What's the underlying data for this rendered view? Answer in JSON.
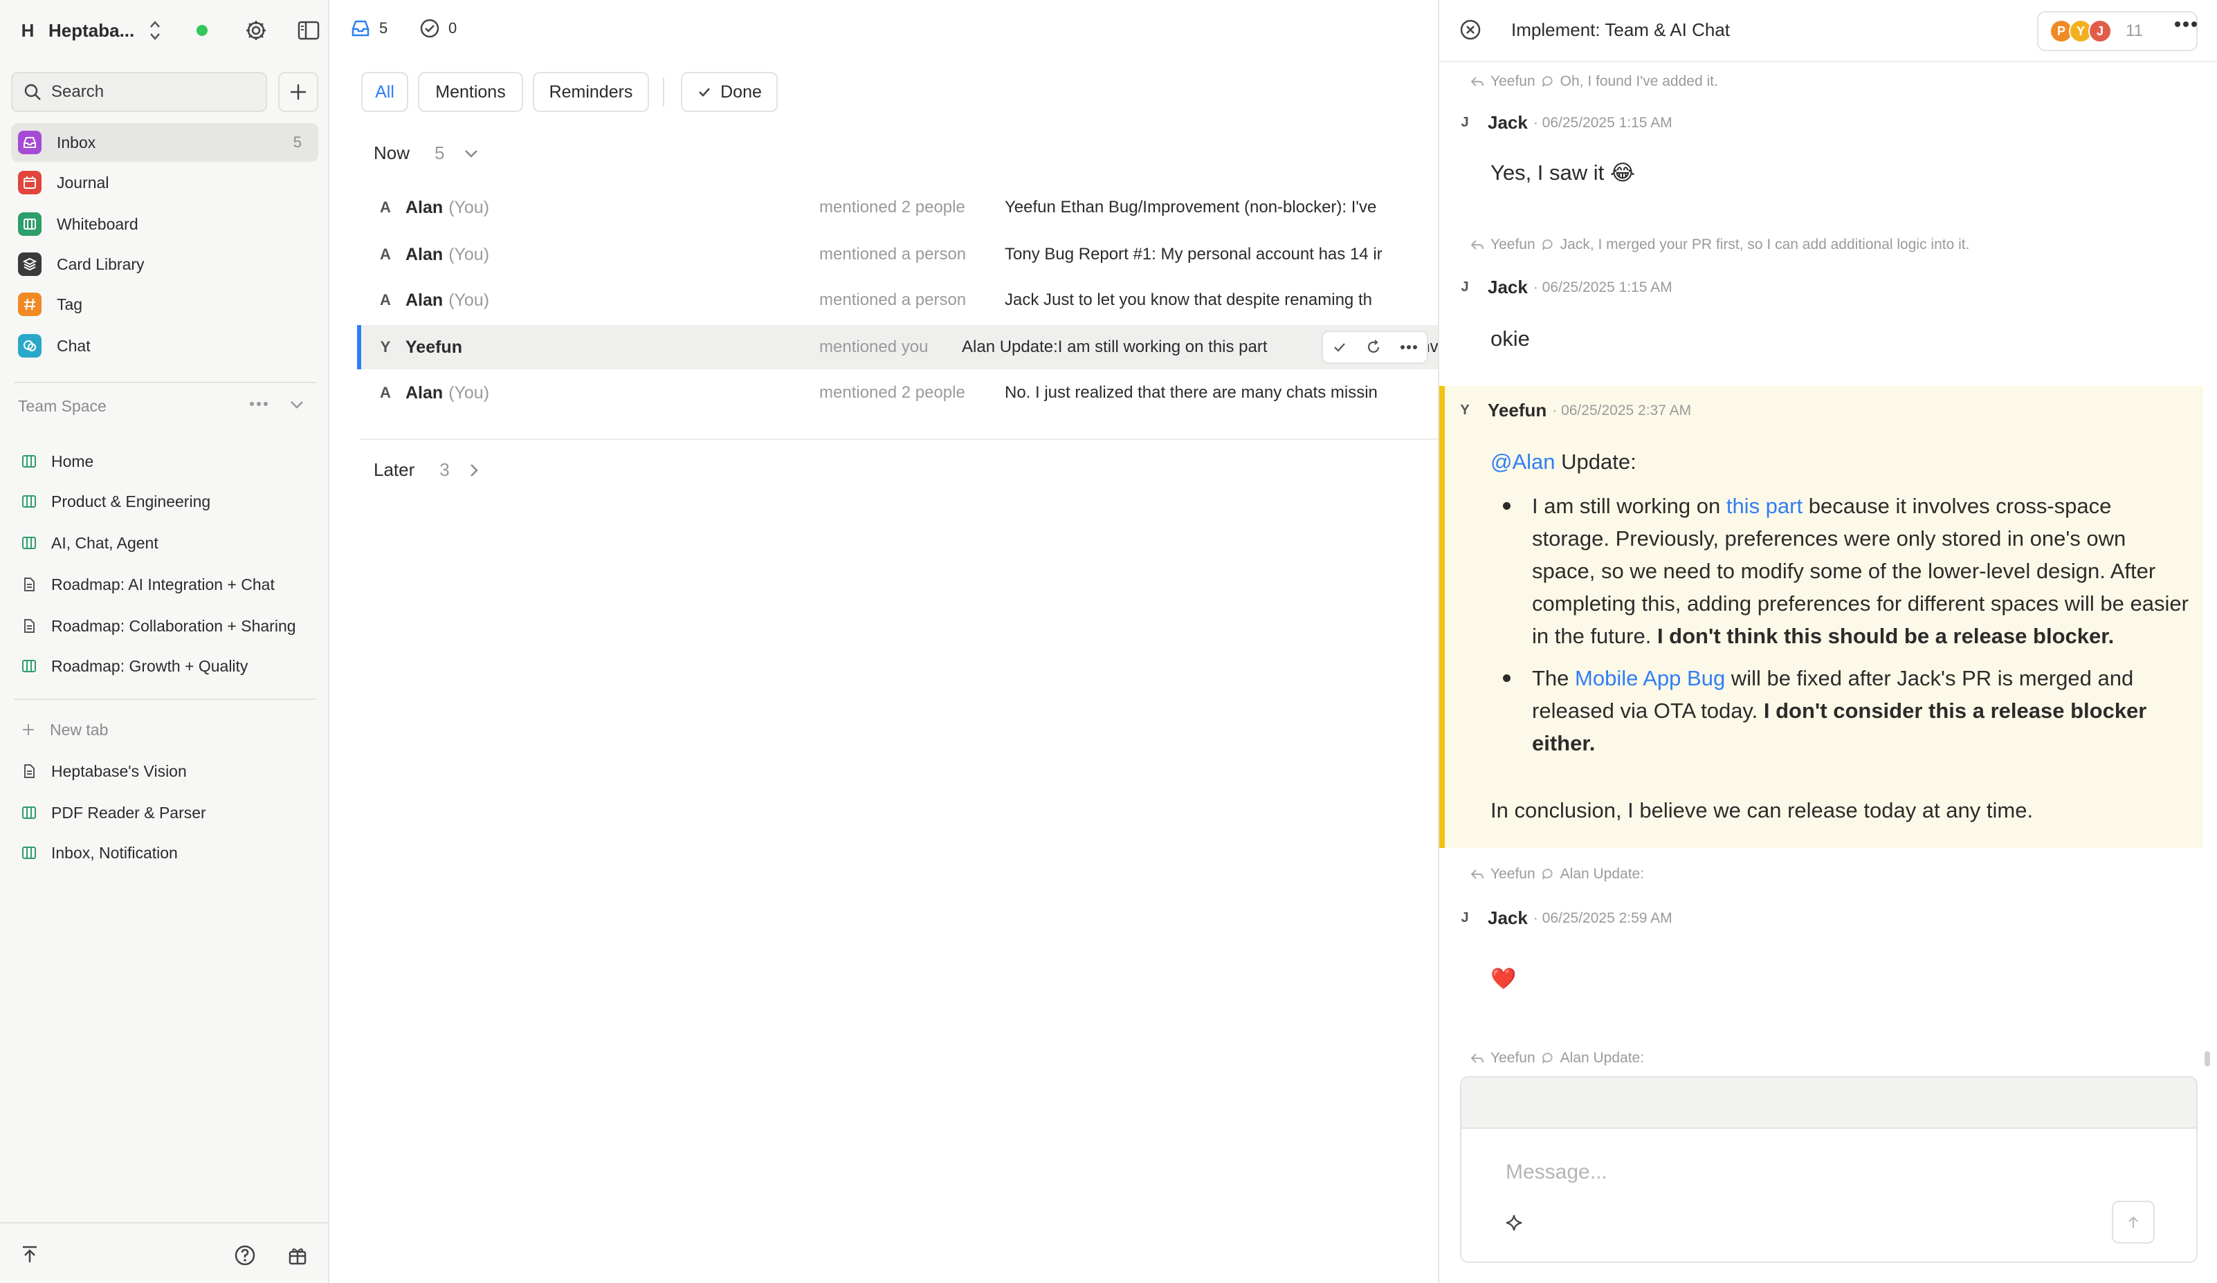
{
  "workspace": {
    "badge": "H",
    "name": "Heptaba..."
  },
  "sidebar": {
    "search_label": "Search",
    "nav": [
      {
        "label": "Inbox",
        "count": "5",
        "icon": "inbox-icon",
        "color": "#a64bd6"
      },
      {
        "label": "Journal",
        "count": "",
        "icon": "calendar-icon",
        "color": "#e2453c"
      },
      {
        "label": "Whiteboard",
        "count": "",
        "icon": "whiteboard-icon",
        "color": "#2e9e6b"
      },
      {
        "label": "Card Library",
        "count": "",
        "icon": "layers-icon",
        "color": "#3a3a3a"
      },
      {
        "label": "Tag",
        "count": "",
        "icon": "hash-icon",
        "color": "#f08a24"
      },
      {
        "label": "Chat",
        "count": "",
        "icon": "chat-icon",
        "color": "#2aa8c7"
      }
    ],
    "section_title": "Team Space",
    "team_items": [
      {
        "label": "Home",
        "icon": "whiteboard-icon"
      },
      {
        "label": "Product & Engineering",
        "icon": "whiteboard-icon"
      },
      {
        "label": "AI, Chat, Agent",
        "icon": "whiteboard-icon"
      },
      {
        "label": "Roadmap: AI Integration + Chat",
        "icon": "document-icon"
      },
      {
        "label": "Roadmap: Collaboration + Sharing",
        "icon": "document-icon"
      },
      {
        "label": "Roadmap: Growth + Quality",
        "icon": "whiteboard-icon"
      }
    ],
    "new_tab_label": "New tab",
    "tabs": [
      {
        "label": "Heptabase's Vision",
        "icon": "document-icon"
      },
      {
        "label": "PDF Reader & Parser",
        "icon": "whiteboard-icon"
      },
      {
        "label": "Inbox, Notification",
        "icon": "whiteboard-icon"
      }
    ]
  },
  "inbox": {
    "top_unread_count": "5",
    "top_done_count": "0",
    "filters": {
      "all": "All",
      "mentions": "Mentions",
      "reminders": "Reminders",
      "done": "Done"
    },
    "now_group": {
      "label": "Now",
      "count": "5"
    },
    "later_group": {
      "label": "Later",
      "count": "3"
    },
    "rows": [
      {
        "avatar": "A",
        "name": "Alan",
        "you": "(You)",
        "action": "mentioned 2 people",
        "preview": "Yeefun Ethan Bug/Improvement (non-blocker): I've"
      },
      {
        "avatar": "A",
        "name": "Alan",
        "you": "(You)",
        "action": "mentioned a person",
        "preview": "Tony Bug Report #1: My personal account has 14 ir"
      },
      {
        "avatar": "A",
        "name": "Alan",
        "you": "(You)",
        "action": "mentioned a person",
        "preview": "Jack Just to let you know that despite renaming th"
      },
      {
        "avatar": "Y",
        "name": "Yeefun",
        "you": "",
        "action": "mentioned you",
        "preview": "Alan Update:I am still working on this part",
        "preview_tail": "inv"
      },
      {
        "avatar": "A",
        "name": "Alan",
        "you": "(You)",
        "action": "mentioned 2 people",
        "preview": "No. I just realized that there are many chats missin"
      }
    ]
  },
  "chat": {
    "title": "Implement: Team & AI Chat",
    "members": [
      {
        "initial": "P",
        "color": "#f08a24"
      },
      {
        "initial": "Y",
        "color": "#f2b01e"
      },
      {
        "initial": "J",
        "color": "#e25c4a"
      }
    ],
    "member_count": "11",
    "messages": {
      "ref1": {
        "name": "Yeefun",
        "text": "Oh, I found I've added it."
      },
      "m1": {
        "avatar": "J",
        "name": "Jack",
        "time": "· 06/25/2025 1:15 AM",
        "body": "Yes, I saw it 😂"
      },
      "ref2": {
        "name": "Yeefun",
        "text": "Jack, I merged your PR first, so I can add additional logic into it."
      },
      "m2": {
        "avatar": "J",
        "name": "Jack",
        "time": "· 06/25/2025 1:15 AM",
        "body": "okie"
      },
      "m3": {
        "avatar": "Y",
        "name": "Yeefun",
        "time": "· 06/25/2025 2:37 AM",
        "mention": "@Alan",
        "lead": " Update:",
        "b1_pre": "I am still working on ",
        "b1_link": "this part",
        "b1_post": " because it involves cross-space storage. Previously, preferences were only stored in one's own space, so we need to modify some of the lower-level design. After completing this, adding preferences for different spaces will be easier in the future. ",
        "b1_bold": "I don't think this should be a release blocker.",
        "b2_pre": "The ",
        "b2_link": "Mobile App Bug",
        "b2_post": " will be fixed after Jack's PR is merged and released via OTA today. ",
        "b2_bold": "I don't consider this a release blocker either.",
        "conclusion": "In conclusion, I believe we can release today at any time."
      },
      "ref3": {
        "name": "Yeefun",
        "text": "Alan Update:"
      },
      "m4": {
        "avatar": "J",
        "name": "Jack",
        "time": "· 06/25/2025 2:59 AM",
        "body": "❤️"
      },
      "ref4": {
        "name": "Yeefun",
        "text": "Alan Update:"
      }
    },
    "composer_placeholder": "Message..."
  },
  "colors": {
    "accent": "#2f7ef5",
    "highlight_bg": "#fdf9e8",
    "highlight_bar": "#f1c40f"
  }
}
